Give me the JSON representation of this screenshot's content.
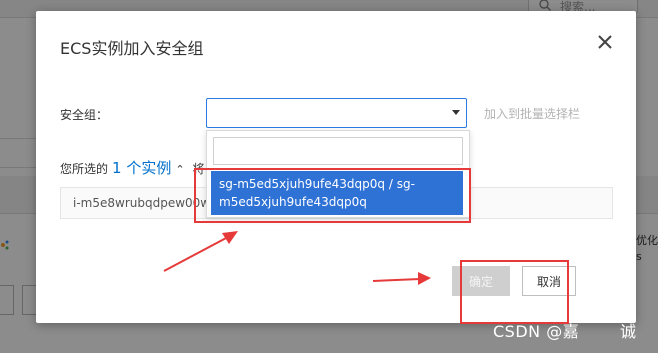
{
  "background": {
    "search_placeholder": "搜索...",
    "right_text": "优化",
    "right_text_2": "s"
  },
  "modal": {
    "title": "ECS实例加入安全组",
    "security_group_label": "安全组：",
    "batch_link": "加入到批量选择栏",
    "selected_prefix": "您所选的",
    "selected_count": "1 个实例",
    "collapse_text": "将",
    "instance_id": "i-m5e8wrubqdpew00wz5",
    "confirm_button": "确定",
    "cancel_button": "取消"
  },
  "dropdown": {
    "search_value": "",
    "option_line1": "sg-m5ed5xjuh9ufe43dqp0q / sg-",
    "option_line2": "m5ed5xjuh9ufe43dqp0q"
  },
  "watermark": {
    "text": "CSDN @嘉",
    "tail": "诚"
  },
  "colors": {
    "accent": "#2c7be5",
    "option_highlight": "#2f72d6",
    "annotation": "#e63a3a",
    "link_disabled": "#b3b3b3"
  }
}
